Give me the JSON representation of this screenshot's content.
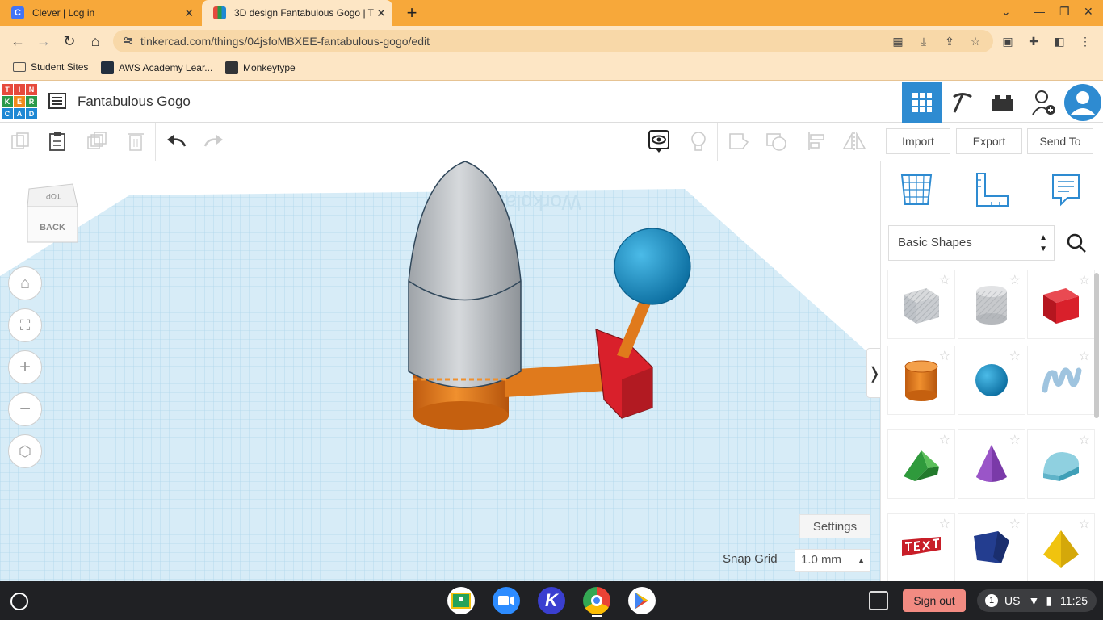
{
  "browser": {
    "tabs": [
      {
        "title": "Clever | Log in",
        "favicon_color": "#4274f6",
        "favicon_letter": "C"
      },
      {
        "title": "3D design Fantabulous Gogo | T",
        "favicon_color": "#e64a3c"
      }
    ],
    "url": "tinkercad.com/things/04jsfoMBXEE-fantabulous-gogo/edit",
    "bookmarks": [
      {
        "label": "Student Sites",
        "icon": "folder-icon"
      },
      {
        "label": "AWS Academy Lear...",
        "icon": "aws-icon"
      },
      {
        "label": "Monkeytype",
        "icon": "monkeytype-icon"
      }
    ],
    "accent": "#f7a83a"
  },
  "header": {
    "logo_letters": [
      "T",
      "I",
      "N",
      "K",
      "E",
      "R",
      "C",
      "A",
      "D"
    ],
    "design_title": "Fantabulous Gogo"
  },
  "toolbar": {
    "import_label": "Import",
    "export_label": "Export",
    "send_to_label": "Send To"
  },
  "viewcube": {
    "top_label": "TOP",
    "back_label": "BACK"
  },
  "workplane": {
    "watermark": "Workplane",
    "settings_label": "Settings",
    "snap_grid_label": "Snap Grid",
    "snap_grid_value": "1.0 mm"
  },
  "right_panel": {
    "category": "Basic Shapes",
    "shapes": [
      {
        "name": "box-hole",
        "color": "#bfc3c8"
      },
      {
        "name": "cylinder-hole",
        "color": "#c7c9cc"
      },
      {
        "name": "box",
        "color": "#d9202b"
      },
      {
        "name": "cylinder",
        "color": "#e8811e"
      },
      {
        "name": "sphere",
        "color": "#1b8fc9"
      },
      {
        "name": "scribble",
        "color": "#9fc4df"
      },
      {
        "name": "roof",
        "color": "#2f9a3c"
      },
      {
        "name": "cone",
        "color": "#7a3aa8"
      },
      {
        "name": "round-roof",
        "color": "#5fb3c9"
      },
      {
        "name": "text",
        "color": "#c81e28"
      },
      {
        "name": "polygon",
        "color": "#233d8f"
      },
      {
        "name": "pyramid",
        "color": "#f0c30f"
      }
    ]
  },
  "shelf": {
    "signout_label": "Sign out",
    "notification_count": "1",
    "locale": "US",
    "time": "11:25"
  }
}
